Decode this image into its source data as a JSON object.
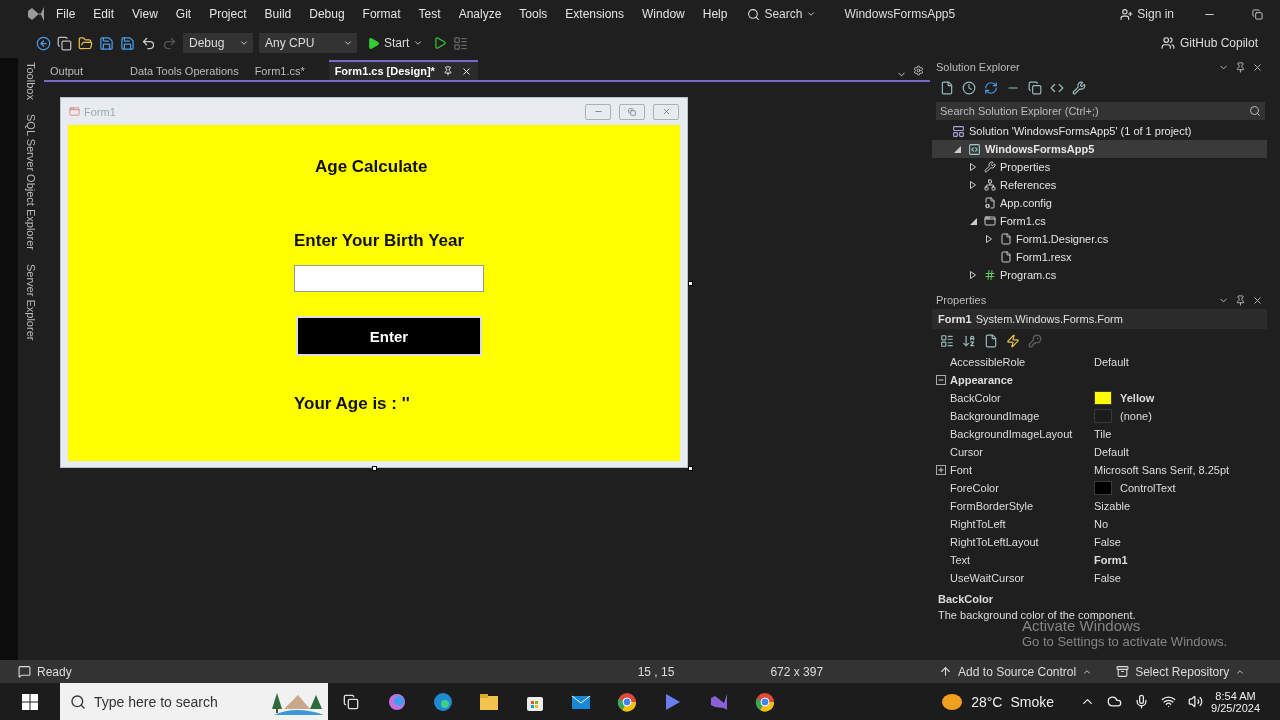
{
  "menu_bar": {
    "items": [
      "File",
      "Edit",
      "View",
      "Git",
      "Project",
      "Build",
      "Debug",
      "Format",
      "Test",
      "Analyze",
      "Tools",
      "Extensions",
      "Window",
      "Help"
    ],
    "search": "Search",
    "solution_name": "WindowsFormsApp5",
    "sign_in": "Sign in"
  },
  "toolbar": {
    "configuration": "Debug",
    "platform": "Any CPU",
    "start": "Start",
    "copilot": "GitHub Copilot"
  },
  "side_tabs": [
    "Toolbox",
    "SQL Server Object Explorer",
    "Server Explorer"
  ],
  "document_tabs": [
    {
      "label": "Output",
      "selected": false
    },
    {
      "label": "Data Tools Operations",
      "selected": false
    },
    {
      "label": "Form1.cs*",
      "selected": false
    },
    {
      "label": "Form1.cs [Design]*",
      "selected": true
    }
  ],
  "designer": {
    "form_title": "Form1",
    "heading": "Age Calculate",
    "prompt": "Enter Your Birth Year",
    "button": "Enter",
    "result": "Your Age is : ''"
  },
  "solution_explorer": {
    "title": "Solution Explorer",
    "search_placeholder": "Search Solution Explorer (Ctrl+;)",
    "tree": [
      {
        "label": "Solution 'WindowsFormsApp5' (1 of 1 project)",
        "kind": "solution",
        "selected": false,
        "children": [
          {
            "label": "WindowsFormsApp5",
            "kind": "project",
            "selected": true,
            "expanded": true,
            "children": [
              {
                "label": "Properties",
                "kind": "wrench",
                "selected": false,
                "expanded": false
              },
              {
                "label": "References",
                "kind": "references",
                "selected": false,
                "expanded": false
              },
              {
                "label": "App.config",
                "kind": "config",
                "selected": false
              },
              {
                "label": "Form1.cs",
                "kind": "form",
                "selected": false,
                "expanded": true,
                "children": [
                  {
                    "label": "Form1.Designer.cs",
                    "kind": "file",
                    "selected": false,
                    "expanded": false
                  },
                  {
                    "label": "Form1.resx",
                    "kind": "file",
                    "selected": false
                  }
                ]
              },
              {
                "label": "Program.cs",
                "kind": "csharp",
                "selected": false,
                "expanded": false
              }
            ]
          }
        ]
      }
    ]
  },
  "properties": {
    "title": "Properties",
    "object": "Form1",
    "type": "System.Windows.Forms.Form",
    "rows": [
      {
        "kind": "property",
        "name": "AccessibleRole",
        "value": "Default",
        "bold": false
      },
      {
        "kind": "category",
        "name": "Appearance",
        "expanded": true
      },
      {
        "kind": "property",
        "name": "BackColor",
        "value": "Yellow",
        "bold": true,
        "color": "#ffff00"
      },
      {
        "kind": "property",
        "name": "BackgroundImage",
        "value": "(none)",
        "bold": false,
        "color": "#1c1c1c"
      },
      {
        "kind": "property",
        "name": "BackgroundImageLayout",
        "value": "Tile",
        "bold": false
      },
      {
        "kind": "property",
        "name": "Cursor",
        "value": "Default",
        "bold": false
      },
      {
        "kind": "property",
        "name": "Font",
        "value": "Microsoft Sans Serif, 8.25pt",
        "bold": false,
        "expanded": false
      },
      {
        "kind": "property",
        "name": "ForeColor",
        "value": "ControlText",
        "bold": false,
        "color": "#000000"
      },
      {
        "kind": "property",
        "name": "FormBorderStyle",
        "value": "Sizable",
        "bold": false
      },
      {
        "kind": "property",
        "name": "RightToLeft",
        "value": "No",
        "bold": false
      },
      {
        "kind": "property",
        "name": "RightToLeftLayout",
        "value": "False",
        "bold": false
      },
      {
        "kind": "property",
        "name": "Text",
        "value": "Form1",
        "bold": true
      },
      {
        "kind": "property",
        "name": "UseWaitCursor",
        "value": "False",
        "bold": false
      }
    ],
    "description_title": "BackColor",
    "description": "The background color of the component."
  },
  "activation": {
    "title": "Activate Windows",
    "hint": "Go to Settings to activate Windows."
  },
  "status_bar": {
    "status": "Ready",
    "position": "15 , 15",
    "size": "672 x 397",
    "source_control": "Add to Source Control",
    "repository": "Select Repository"
  },
  "taskbar": {
    "search_placeholder": "Type here to search",
    "temperature": "28°C",
    "weather": "Smoke",
    "time": "8:54 AM",
    "date": "9/25/2024"
  }
}
